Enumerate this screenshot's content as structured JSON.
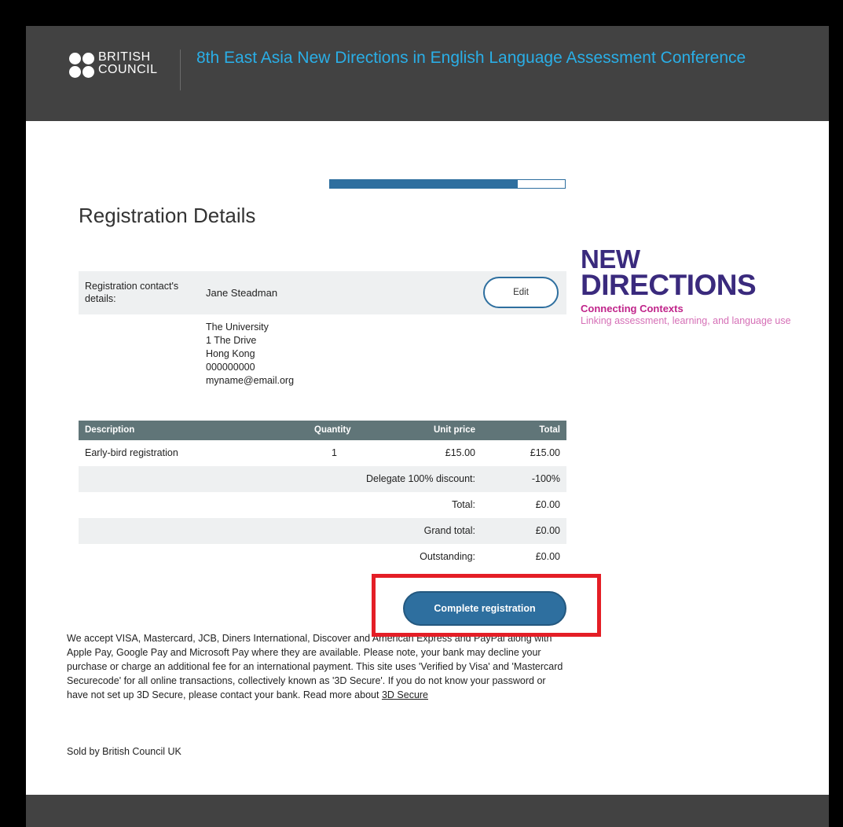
{
  "header": {
    "logo": {
      "line1": "BRITISH",
      "line2": "COUNCIL"
    },
    "conference_title": "8th East Asia New Directions in English Language Assessment Conference"
  },
  "progress": {
    "percent": 80
  },
  "page_title": "Registration Details",
  "contact": {
    "label": "Registration contact's details:",
    "name": "Jane Steadman",
    "edit_label": "Edit",
    "address": [
      "The University",
      "1 The Drive",
      "Hong Kong",
      "000000000",
      "myname@email.org"
    ]
  },
  "order": {
    "columns": {
      "description": "Description",
      "quantity": "Quantity",
      "unit_price": "Unit price",
      "total": "Total"
    },
    "item": {
      "description": "Early-bird registration",
      "quantity": "1",
      "unit_price": "£15.00",
      "total": "£15.00"
    },
    "summary": [
      {
        "label": "Delegate 100% discount:",
        "value": "-100%"
      },
      {
        "label": "Total:",
        "value": "£0.00"
      },
      {
        "label": "Grand total:",
        "value": "£0.00"
      },
      {
        "label": "Outstanding:",
        "value": "£0.00"
      }
    ]
  },
  "complete_button": "Complete registration",
  "payment": {
    "text": "We accept VISA, Mastercard, JCB, Diners International, Discover and American Express and PayPal along with Apple Pay, Google Pay and Microsoft Pay where they are available. Please note, your bank may decline your purchase or charge an additional fee for an international payment. This site uses 'Verified by Visa' and 'Mastercard Securecode' for all online transactions, collectively known as '3D Secure'. If you do not know your password or have not set up 3D Secure, please contact your bank. Read more about ",
    "link_text": "3D Secure"
  },
  "sold_by": "Sold by British Council UK",
  "side_logo": {
    "line1": "NEW",
    "line2": "DIRECTIONS",
    "subtitle": "Connecting Contexts",
    "tagline": "Linking assessment, learning, and language use"
  },
  "colors": {
    "header_bg": "#424242",
    "accent_blue": "#2e6f9f",
    "title_blue": "#2aaee6",
    "highlight_red": "#e41e26"
  }
}
